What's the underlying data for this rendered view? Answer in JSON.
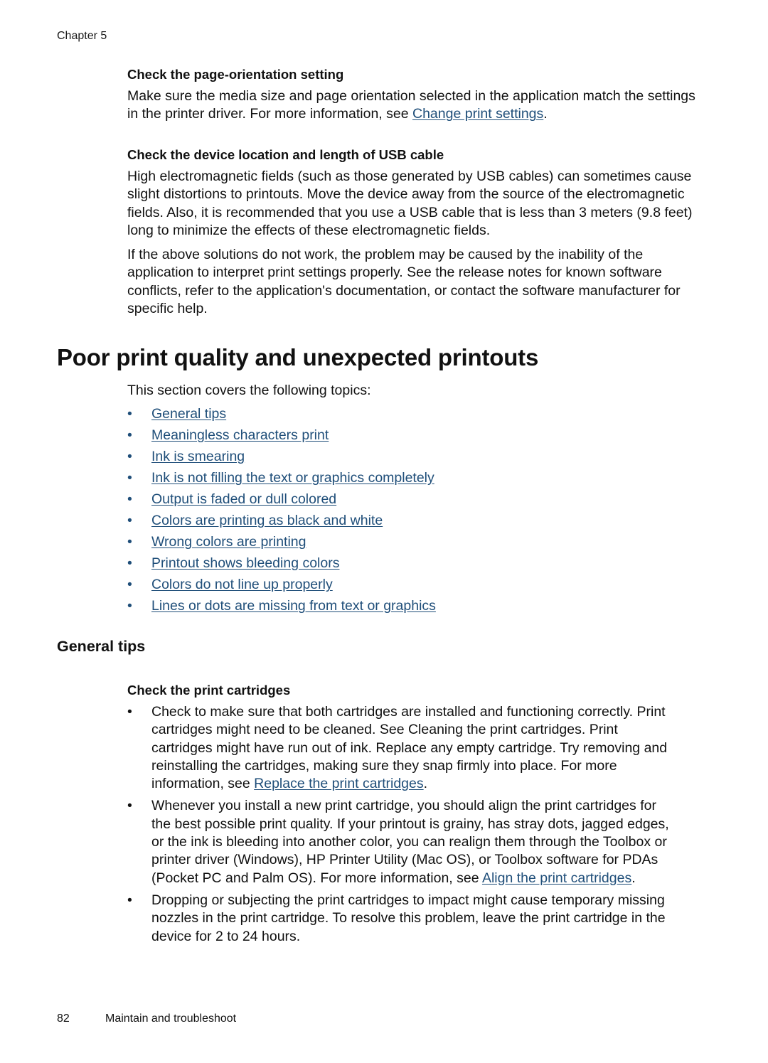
{
  "header": {
    "chapter": "Chapter 5"
  },
  "section_orientation": {
    "heading": "Check the page-orientation setting",
    "text_before": "Make sure the media size and page orientation selected in the application match the settings in the printer driver. For more information, see ",
    "link": "Change print settings",
    "text_after": "."
  },
  "section_usb": {
    "heading": "Check the device location and length of USB cable",
    "paragraph1": "High electromagnetic fields (such as those generated by USB cables) can sometimes cause slight distortions to printouts. Move the device away from the source of the electromagnetic fields. Also, it is recommended that you use a USB cable that is less than 3 meters (9.8 feet) long to minimize the effects of these electromagnetic fields.",
    "paragraph2": "If the above solutions do not work, the problem may be caused by the inability of the application to interpret print settings properly. See the release notes for known software conflicts, refer to the application's documentation, or contact the software manufacturer for specific help."
  },
  "main_section": {
    "title": "Poor print quality and unexpected printouts",
    "intro": "This section covers the following topics:",
    "bullet": "•",
    "topics": [
      "General tips",
      "Meaningless characters print",
      "Ink is smearing",
      "Ink is not filling the text or graphics completely",
      "Output is faded or dull colored",
      "Colors are printing as black and white",
      "Wrong colors are printing",
      "Printout shows bleeding colors",
      "Colors do not line up properly",
      "Lines or dots are missing from text or graphics"
    ]
  },
  "general_tips": {
    "title": "General tips",
    "subheading": "Check the print cartridges",
    "bullet": "•",
    "tip1": {
      "text_before": "Check to make sure that both cartridges are installed and functioning correctly. Print cartridges might need to be cleaned. See Cleaning the print cartridges. Print cartridges might have run out of ink. Replace any empty cartridge. Try removing and reinstalling the cartridges, making sure they snap firmly into place. For more information, see ",
      "link": "Replace the print cartridges",
      "text_after": "."
    },
    "tip2": {
      "text_before": "Whenever you install a new print cartridge, you should align the print cartridges for the best possible print quality. If your printout is grainy, has stray dots, jagged edges, or the ink is bleeding into another color, you can realign them through the Toolbox or printer driver (Windows), HP Printer Utility (Mac OS), or Toolbox software for PDAs (Pocket PC and Palm OS). For more information, see ",
      "link": "Align the print cartridges",
      "text_after": "."
    },
    "tip3": {
      "text": "Dropping or subjecting the print cartridges to impact might cause temporary missing nozzles in the print cartridge. To resolve this problem, leave the print cartridge in the device for 2 to 24 hours."
    }
  },
  "footer": {
    "page_number": "82",
    "section_title": "Maintain and troubleshoot"
  },
  "colors": {
    "link": "#1f4e79",
    "text": "#111111"
  }
}
